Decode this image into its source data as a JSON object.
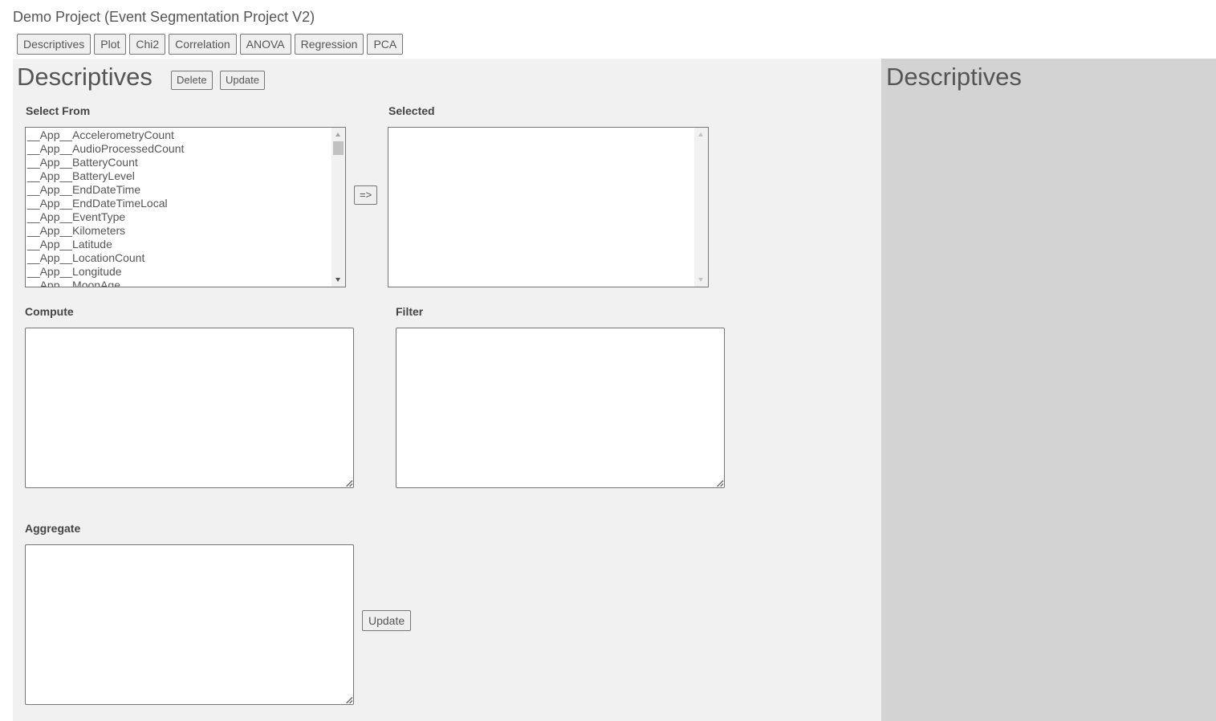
{
  "header": {
    "title": "Demo Project (Event Segmentation Project V2)"
  },
  "tabs": [
    {
      "label": "Descriptives"
    },
    {
      "label": "Plot"
    },
    {
      "label": "Chi2"
    },
    {
      "label": "Correlation"
    },
    {
      "label": "ANOVA"
    },
    {
      "label": "Regression"
    },
    {
      "label": "PCA"
    }
  ],
  "main": {
    "heading": "Descriptives",
    "delete_label": "Delete",
    "update_label": "Update",
    "select_from": {
      "label": "Select From",
      "items": [
        "__App__AccelerometryCount",
        "__App__AudioProcessedCount",
        "__App__BatteryCount",
        "__App__BatteryLevel",
        "__App__EndDateTime",
        "__App__EndDateTimeLocal",
        "__App__EventType",
        "__App__Kilometers",
        "__App__Latitude",
        "__App__LocationCount",
        "__App__Longitude",
        "__App__MoonAge"
      ]
    },
    "move_button_label": "=>",
    "selected": {
      "label": "Selected",
      "items": []
    },
    "compute": {
      "label": "Compute",
      "value": ""
    },
    "filter": {
      "label": "Filter",
      "value": ""
    },
    "aggregate": {
      "label": "Aggregate",
      "value": ""
    },
    "aggregate_update_label": "Update"
  },
  "side": {
    "heading": "Descriptives"
  },
  "colors": {
    "main_panel_bg": "#f1f1f1",
    "side_panel_bg": "#d3d3d3",
    "button_bg": "#efefef"
  }
}
